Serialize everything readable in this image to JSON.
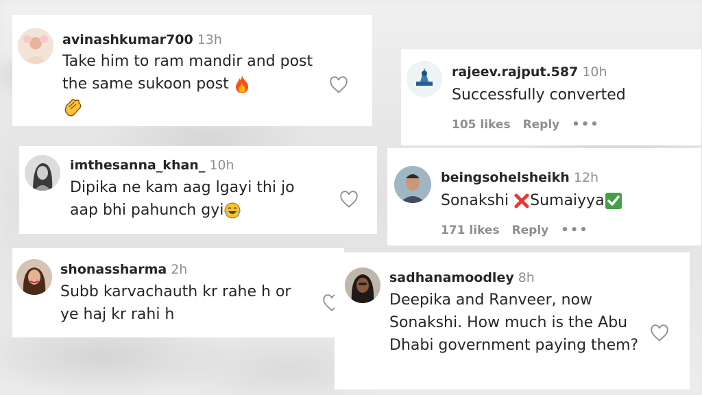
{
  "comments": [
    {
      "username": "avinashkumar700",
      "time": "13h",
      "text": "Take him to ram mandir and post the same sukoon post",
      "emojis": [
        "fire-emoji",
        "clapping-hands-emoji"
      ]
    },
    {
      "username": "rajeev.rajput.587",
      "time": "10h",
      "text": "Successfully converted",
      "likes": "105 likes",
      "reply": "Reply",
      "more": "•••"
    },
    {
      "username": "imthesanna_khan_",
      "time": "10h",
      "text": "Dipika ne kam aag lgayi thi jo aap bhi pahunch gyi",
      "emojis": [
        "tears-of-joy-emoji"
      ]
    },
    {
      "username": "beingsohelsheikh",
      "time": "12h",
      "text_before": "Sonakshi",
      "text_after": "Sumaiyya",
      "emojis": [
        "cross-mark-emoji",
        "check-mark-emoji"
      ],
      "likes": "171 likes",
      "reply": "Reply",
      "more": "•••"
    },
    {
      "username": "shonassharma",
      "time": "2h",
      "text": "Subb karvachauth kr rahe h or ye haj kr rahi h"
    },
    {
      "username": "sadhanamoodley",
      "time": "8h",
      "text": "Deepika and Ranveer, now Sonakshi. How much is the Abu Dhabi government paying them?"
    }
  ],
  "colors": {
    "username": "#262626",
    "muted": "#8e8e8e",
    "card": "#ffffff"
  }
}
